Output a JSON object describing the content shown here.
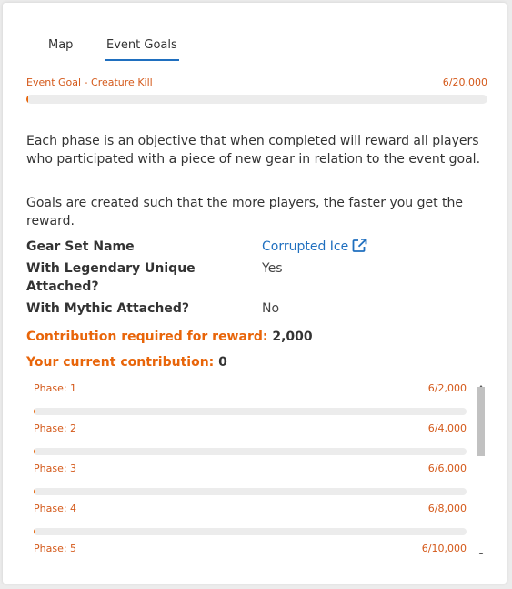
{
  "tabs": [
    {
      "label": "Map",
      "active": false
    },
    {
      "label": "Event Goals",
      "active": true
    }
  ],
  "event_goal": {
    "label": "Event Goal - Creature Kill",
    "progress_text": "6/20,000",
    "progress_fraction": 0.0003
  },
  "description": [
    "Each phase is an objective that when completed will reward all players who participated with a piece of new gear in relation to the event goal.",
    "Goals are created such that the more players, the faster you get the reward."
  ],
  "properties": {
    "gear_set": {
      "label": "Gear Set Name",
      "value": "Corrupted Ice"
    },
    "legendary": {
      "label": "With Legendary Unique Attached?",
      "value": "Yes"
    },
    "mythic": {
      "label": "With Mythic Attached?",
      "value": "No"
    }
  },
  "contribution": {
    "required_label": "Contribution required for reward:",
    "required_value": "2,000",
    "current_label": "Your current contribution:",
    "current_value": "0"
  },
  "phases": [
    {
      "label": "Phase: 1",
      "progress_text": "6/2,000",
      "fraction": 0.003
    },
    {
      "label": "Phase: 2",
      "progress_text": "6/4,000",
      "fraction": 0.0015
    },
    {
      "label": "Phase: 3",
      "progress_text": "6/6,000",
      "fraction": 0.001
    },
    {
      "label": "Phase: 4",
      "progress_text": "6/8,000",
      "fraction": 0.00075
    },
    {
      "label": "Phase: 5",
      "progress_text": "6/10,000",
      "fraction": 0.0006
    }
  ],
  "colors": {
    "accent_orange": "#e8650a",
    "link_blue": "#1f6fbf"
  },
  "icons": {
    "external_link": "external-link-icon"
  }
}
